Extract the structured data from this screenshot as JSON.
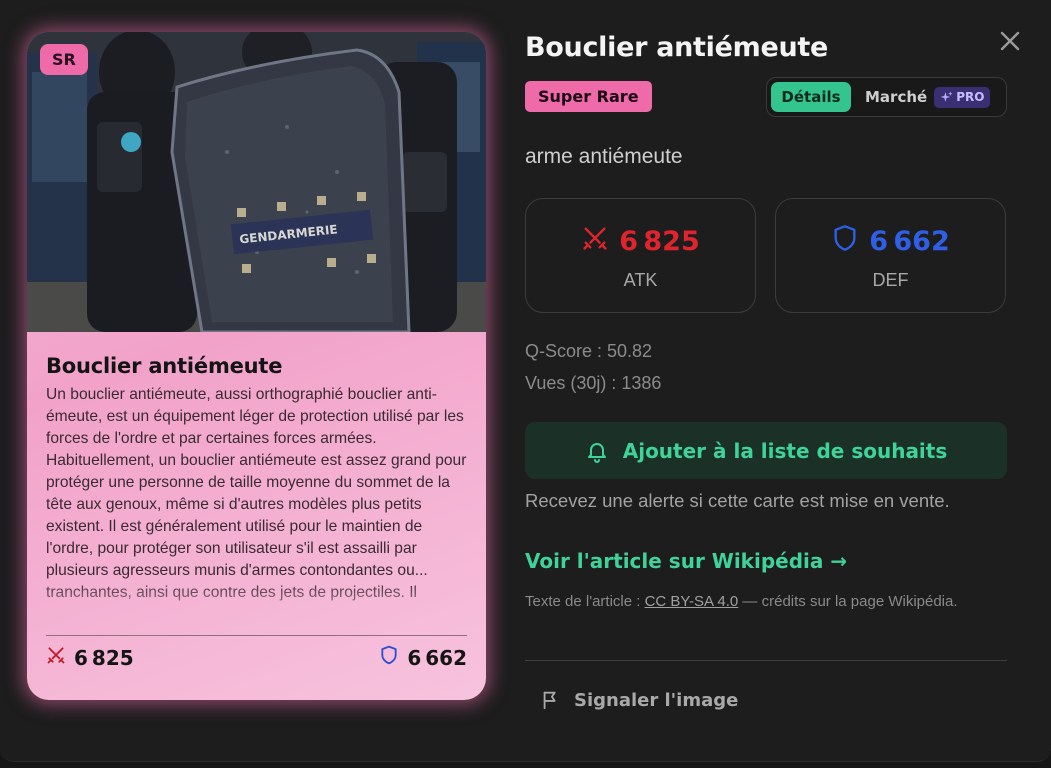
{
  "card": {
    "rarity_tag": "SR",
    "title": "Bouclier antiémeute",
    "description": "Un bouclier antiémeute, aussi orthographié bouclier anti-émeute, est un équipement léger de protection utilisé par les forces de l'ordre et par certaines forces armées. Habituellement, un bouclier antiémeute est assez grand pour protéger une personne de taille moyenne du sommet de la tête aux genoux, même si d'autres modèles plus petits existent. Il est généralement utilisé pour le maintien de l'ordre, pour protéger son utilisateur s'il est assailli par plusieurs agresseurs munis d'armes contondantes ou... tranchantes, ainsi que contre des jets de projectiles. Il",
    "shield_text": "GENDARMERIE",
    "atk": "6825",
    "def": "6662"
  },
  "details": {
    "title": "Bouclier antiémeute",
    "rarity": "Super Rare",
    "tabs": {
      "details": "Détails",
      "market": "Marché",
      "pro": "PRO"
    },
    "subtitle": "arme antiémeute",
    "atk_value": "6825",
    "atk_label": "ATK",
    "def_value": "6662",
    "def_label": "DEF",
    "qscore": "Q-Score : 50.82",
    "views": "Vues (30j) : 1386",
    "wishlist_button": "Ajouter à la liste de souhaits",
    "wishlist_hint": "Recevez une alerte si cette carte est mise en vente.",
    "wiki_link": "Voir l'article sur Wikipédia →",
    "credits_prefix": "Texte de l'article : ",
    "credits_license": "CC BY-SA 4.0",
    "credits_suffix": " — crédits sur la page Wikipédia.",
    "report": "Signaler l'image"
  },
  "colors": {
    "accent_green": "#3fd39a",
    "rarity_pink": "#ee6aa8",
    "atk_red": "#e0242e",
    "def_blue": "#2f5fe6",
    "pro_purple": "#3b2f73"
  }
}
